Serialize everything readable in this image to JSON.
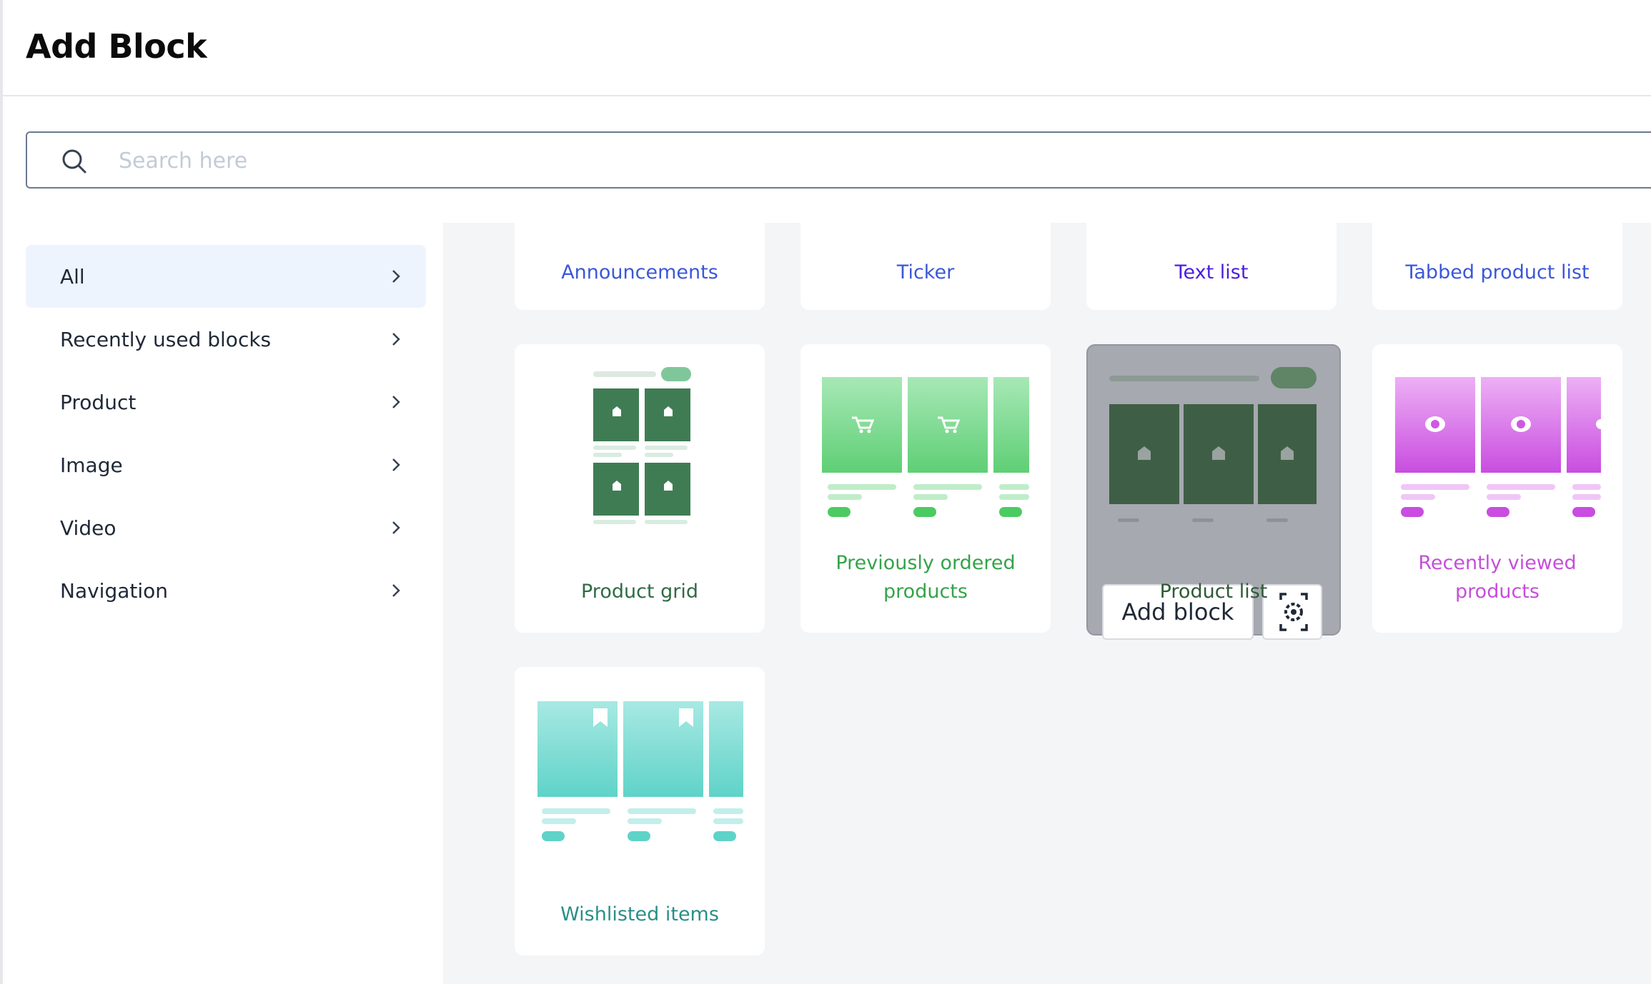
{
  "header": {
    "title": "Add Block"
  },
  "search": {
    "placeholder": "Search here",
    "value": ""
  },
  "sidebar": {
    "items": [
      {
        "label": "All",
        "active": true
      },
      {
        "label": "Recently used blocks",
        "active": false
      },
      {
        "label": "Product",
        "active": false
      },
      {
        "label": "Image",
        "active": false
      },
      {
        "label": "Video",
        "active": false
      },
      {
        "label": "Navigation",
        "active": false
      }
    ]
  },
  "blocks": {
    "announcements": "Announcements",
    "ticker": "Ticker",
    "text_list": "Text list",
    "tabbed_product_list": "Tabbed product list",
    "product_grid": "Product grid",
    "previously_ordered": "Previously ordered products",
    "product_list": "Product list",
    "recently_viewed": "Recently viewed products",
    "wishlisted": "Wishlisted items"
  },
  "overlay": {
    "add_label": "Add block",
    "gear_icon": "settings-gear-icon"
  },
  "colors": {
    "link_blue": "#3b58d9",
    "text_purple": "#4c1fe0",
    "green_dark": "#2f6b44",
    "green_bright": "#35a34a",
    "purple": "#c54fd9",
    "teal": "#2a8f89"
  }
}
